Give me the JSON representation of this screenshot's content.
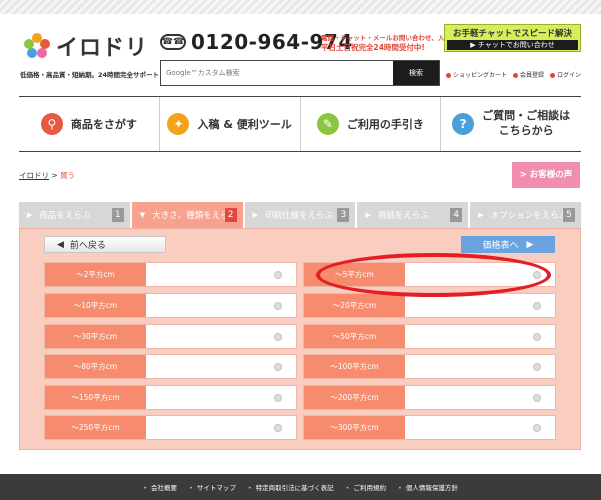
{
  "header": {
    "logo_text": "イロドリ",
    "tagline": "低価格・高品質・短納期。24時間完全サポート",
    "phone_icon": "☎☎",
    "phone": "0120-964-974",
    "phone_note_1": "電話・チャット・メールお問い合わせ、入稿",
    "phone_note_2": "平日土日祝完全24時間受付中!",
    "chat_title": "お手軽チャットでスピード解決",
    "chat_button": "▶ チャットでお問い合わせ",
    "search_placeholder": "Google™カスタム検索",
    "search_button": "検索",
    "links": [
      "ショッピングカート",
      "会員登録",
      "ログイン"
    ]
  },
  "nav": {
    "items": [
      {
        "label": "商品をさがす",
        "icon": "search-icon",
        "color": "#e8573f",
        "glyph": "🔍"
      },
      {
        "label": "入稿 & 便利ツール",
        "icon": "lightbulb-icon",
        "color": "#f3a21b",
        "glyph": "💡"
      },
      {
        "label": "ご利用の手引き",
        "icon": "pencil-icon",
        "color": "#8cc63f",
        "glyph": "✎"
      },
      {
        "label": "ご質問・ご相談は\nこちらから",
        "icon": "question-icon",
        "color": "#4a9fd8",
        "glyph": "?"
      }
    ]
  },
  "breadcrumb": {
    "home": "イロドリ",
    "sep": " > ",
    "current": "貿う"
  },
  "voice_button": "> お客様の声",
  "steps": [
    {
      "label": "商品をえらぶ",
      "num": "1",
      "active": false
    },
    {
      "label": "大きさ、種類をえらぶ",
      "num": "2",
      "active": true
    },
    {
      "label": "印刷仕様をえらぶ",
      "num": "3",
      "active": false
    },
    {
      "label": "用紙をえらぶ",
      "num": "4",
      "active": false
    },
    {
      "label": "オプションをえらぶ",
      "num": "5",
      "active": false
    }
  ],
  "back_button": "前へ戻る",
  "price_button": "価格表へ",
  "options_left": [
    "〜2平方cm",
    "〜10平方cm",
    "〜30平方cm",
    "〜80平方cm",
    "〜150平方cm",
    "〜250平方cm"
  ],
  "options_right": [
    "〜5平方cm",
    "〜20平方cm",
    "〜50平方cm",
    "〜100平方cm",
    "〜200平方cm",
    "〜300平方cm"
  ],
  "footer": {
    "links": [
      "会社概要",
      "サイトマップ",
      "特定商取引法に基づく表記",
      "ご利用規約",
      "個人情報保護方針"
    ]
  },
  "colors": {
    "accent": "#e1473a",
    "step_active": "#f7a28f",
    "panel_bg": "#f9cdbf",
    "option_label": "#f68b6e",
    "price_button": "#6aa4e0",
    "highlight_ring": "#e31e24"
  }
}
